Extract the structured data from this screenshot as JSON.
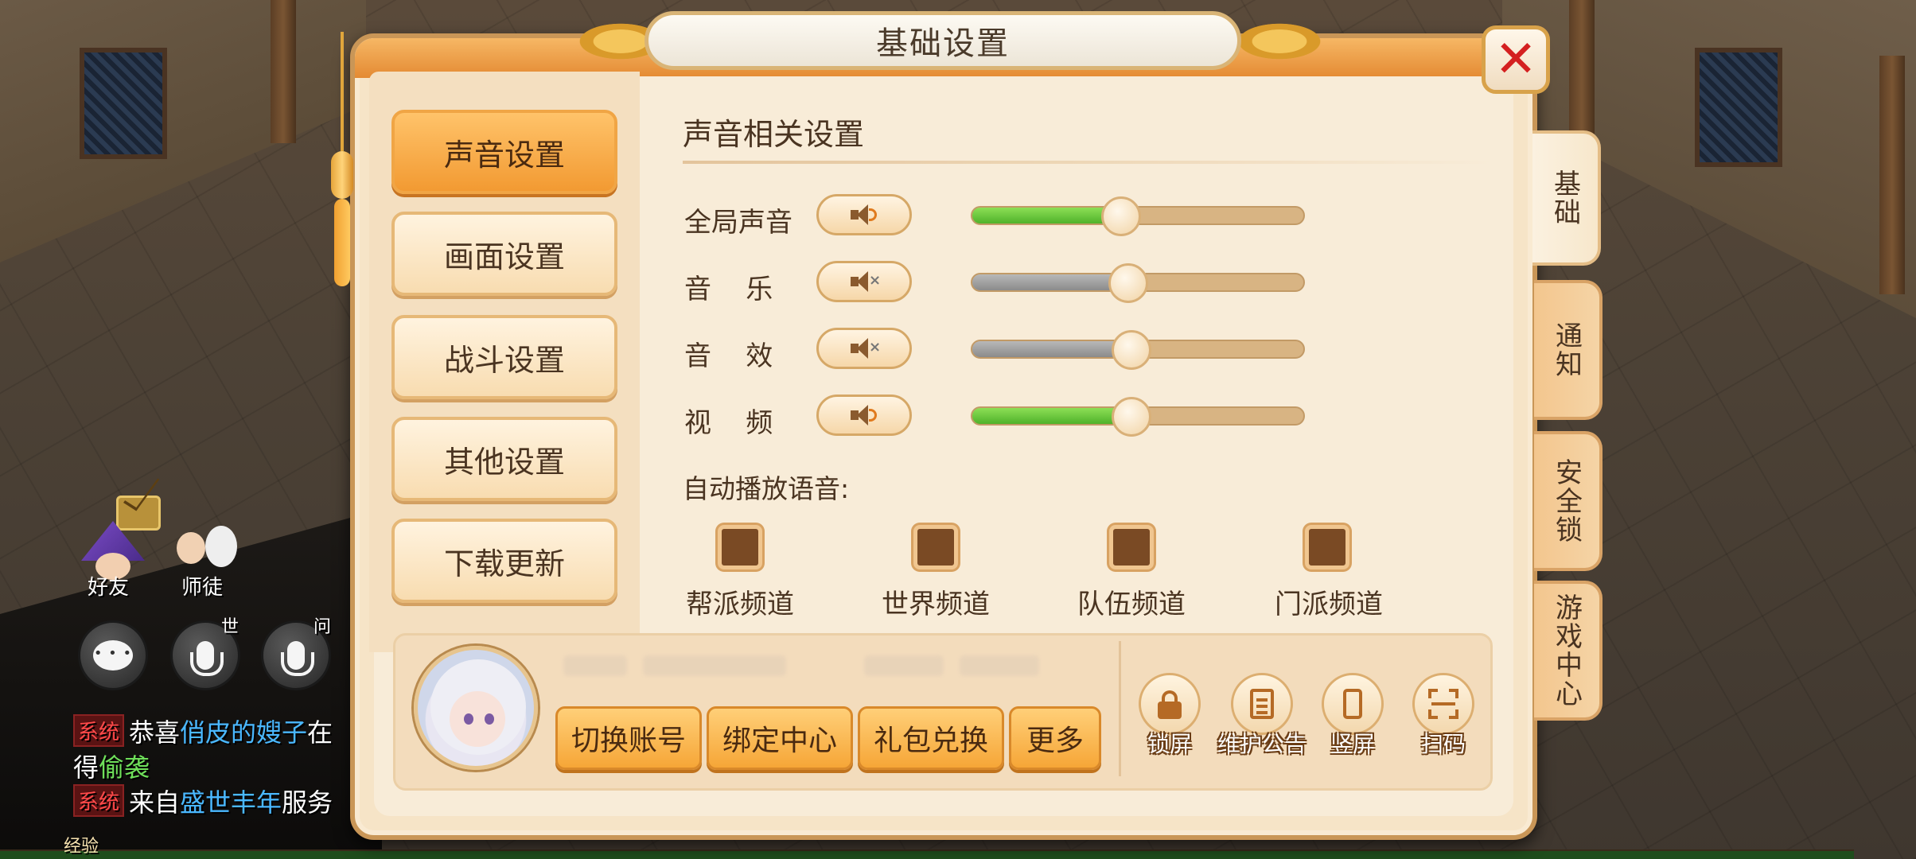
{
  "dialog": {
    "title": "基础设置",
    "close_label": "✕"
  },
  "categories": [
    {
      "label": "声音设置",
      "active": true
    },
    {
      "label": "画面设置",
      "active": false
    },
    {
      "label": "战斗设置",
      "active": false
    },
    {
      "label": "其他设置",
      "active": false
    },
    {
      "label": "下载更新",
      "active": false
    }
  ],
  "side_tabs": [
    {
      "label": "基础",
      "active": true
    },
    {
      "label": "通知",
      "active": false
    },
    {
      "label": "安全锁",
      "active": false
    },
    {
      "label": "游戏中心",
      "active": false
    }
  ],
  "sound": {
    "section_title": "声音相关设置",
    "rows": [
      {
        "label": "全局声音",
        "muted": false,
        "level": 0.45
      },
      {
        "label": "音    乐",
        "muted": true,
        "level": 0.47
      },
      {
        "label": "音    效",
        "muted": true,
        "level": 0.48
      },
      {
        "label": "视    频",
        "muted": false,
        "level": 0.48
      }
    ],
    "auto_play_label": "自动播放语音:",
    "channels": [
      {
        "label": "帮派频道",
        "checked": false
      },
      {
        "label": "世界频道",
        "checked": false
      },
      {
        "label": "队伍频道",
        "checked": false
      },
      {
        "label": "门派频道",
        "checked": false
      }
    ]
  },
  "account": {
    "buttons": [
      "切换账号",
      "绑定中心",
      "礼包兑换",
      "更多"
    ],
    "tools": [
      {
        "label": "锁屏",
        "icon": "lock-icon"
      },
      {
        "label": "维护公告",
        "icon": "notice-icon"
      },
      {
        "label": "竖屏",
        "icon": "portrait-icon"
      },
      {
        "label": "扫码",
        "icon": "scan-icon"
      }
    ]
  },
  "hud": {
    "friends_label": "好友",
    "mentor_label": "师徒",
    "world_tag": "世",
    "ask_tag": "问",
    "exp_label": "经验"
  },
  "chat": {
    "lines": [
      {
        "tag": "系统",
        "parts": [
          "恭喜",
          "俏皮的嫂子",
          "在"
        ]
      },
      {
        "tag": "",
        "parts": [
          "得",
          "偷袭"
        ]
      },
      {
        "tag": "系统",
        "parts": [
          "来自",
          "盛世丰年",
          "服务"
        ]
      }
    ]
  },
  "colors": {
    "accent": "#f29a32",
    "slider_on": "#4fb22b",
    "slider_off": "#8b8b8b",
    "close_red": "#d42020",
    "panel_bg": "#f6e4c7"
  }
}
